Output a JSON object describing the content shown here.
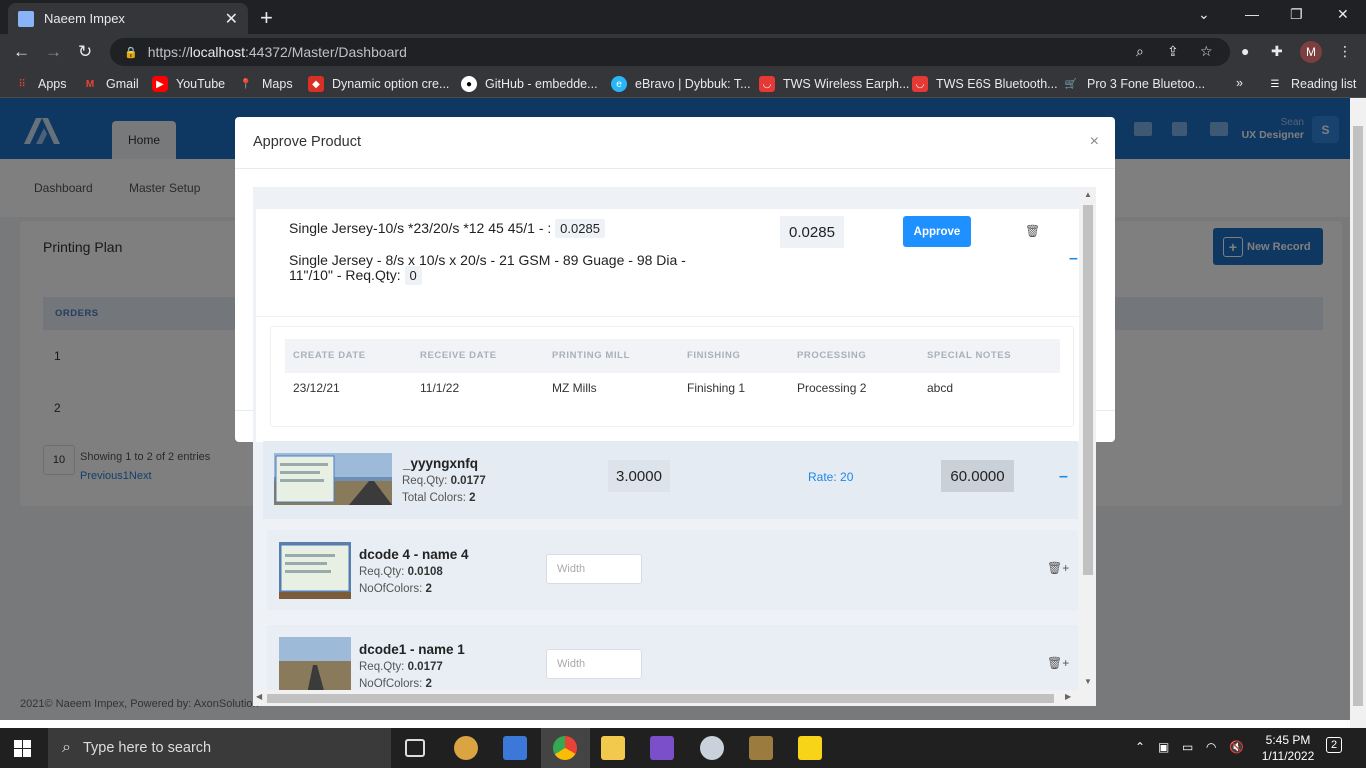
{
  "browser": {
    "tab_title": "Naeem Impex",
    "url_prefix": "https://",
    "url_host": "localhost",
    "url_rest": ":44372/Master/Dashboard",
    "profile_initial": "M",
    "bookmarks": [
      {
        "label": "Apps",
        "color": "#ea4335"
      },
      {
        "label": "Gmail",
        "color": "#ea4335"
      },
      {
        "label": "YouTube",
        "color": "#ff0000"
      },
      {
        "label": "Maps",
        "color": "#34a853"
      },
      {
        "label": "Dynamic option cre...",
        "color": "#d93025"
      },
      {
        "label": "GitHub - embedde...",
        "color": "#ffffff"
      },
      {
        "label": "eBravo | Dybbuk: T...",
        "color": "#29b6f6"
      },
      {
        "label": "TWS Wireless Earph...",
        "color": "#e53935"
      },
      {
        "label": "TWS E6S Bluetooth...",
        "color": "#e53935"
      },
      {
        "label": "Pro 3 Fone Bluetoo...",
        "color": "#e53935"
      }
    ],
    "more": "»",
    "reading_list": "Reading list"
  },
  "app": {
    "home_tab": "Home",
    "user_name": "Sean",
    "user_role": "UX Designer",
    "user_initial": "S",
    "subnav": [
      "Dashboard",
      "Master Setup"
    ],
    "card_title": "Printing Plan",
    "new_record": "New Record",
    "orders_header": "ORDERS",
    "orders": [
      "1",
      "2"
    ],
    "page_size": "10",
    "showing": "Showing 1 to 2 of 2 entries",
    "pager": "Previous1Next",
    "footer": "2021©  Naeem Impex, Powered by: AxonSolution"
  },
  "modal": {
    "title": "Approve Product",
    "close": "×",
    "spec1_text": "Single Jersey-10/s *23/20/s *12 45 45/1 - :",
    "spec1_value": "0.0285",
    "spec2_text": "Single Jersey - 8/s x 10/s x 20/s - 21 GSM - 89 Guage - 98 Dia - 11\"/10\" - Req.Qty:",
    "spec2_value": "0",
    "rate_value": "0.0285",
    "approve_label": "Approve",
    "detail_headers": [
      "CREATE DATE",
      "RECEIVE DATE",
      "PRINTING MILL",
      "FINISHING",
      "PROCESSING",
      "SPECIAL NOTES"
    ],
    "detail_values": [
      "23/12/21",
      "11/1/22",
      "MZ Mills",
      "Finishing 1",
      "Processing 2",
      "abcd"
    ],
    "design": {
      "name": "_yyyngxnfq",
      "req_label": "Req.Qty:",
      "req_value": "0.0177",
      "colors_label": "Total Colors:",
      "colors_value": "2",
      "qty": "3.0000",
      "rate": "Rate: 20",
      "total": "60.0000"
    },
    "subs": [
      {
        "name": "dcode 4 - name 4",
        "req_label": "Req.Qty:",
        "req_value": "0.0108",
        "colors_label": "NoOfColors:",
        "colors_value": "2",
        "width_placeholder": "Width",
        "actions": "🗑+"
      },
      {
        "name": "dcode1 - name 1",
        "req_label": "Req.Qty:",
        "req_value": "0.0177",
        "colors_label": "NoOfColors:",
        "colors_value": "2",
        "width_placeholder": "Width",
        "actions": "🗑+"
      }
    ]
  },
  "taskbar": {
    "search_placeholder": "Type here to search",
    "time": "5:45 PM",
    "date": "1/11/2022",
    "notif_count": "2"
  }
}
